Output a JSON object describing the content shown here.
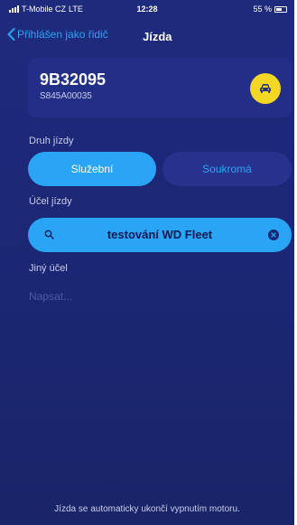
{
  "status_bar": {
    "carrier": "T-Mobile CZ",
    "network": "LTE",
    "time": "12:28",
    "battery": "55 %"
  },
  "nav": {
    "back_label": "Přihlášen jako řidič",
    "title": "Jízda"
  },
  "vehicle": {
    "plate": "9B32095",
    "vin": "S845A00035",
    "icon": "car-icon"
  },
  "trip_type": {
    "label": "Druh jízdy",
    "options": [
      "Služební",
      "Soukromá"
    ],
    "selected": "Služební"
  },
  "purpose": {
    "label": "Účel jízdy",
    "value": "testování WD Fleet"
  },
  "other_purpose": {
    "label": "Jiný účel",
    "placeholder": "Napsat..."
  },
  "footer_note": "Jízda se automaticky ukončí vypnutím motoru.",
  "colors": {
    "background": "#1e2a7c",
    "accent": "#2aa4f4",
    "car_button": "#f4d625"
  }
}
